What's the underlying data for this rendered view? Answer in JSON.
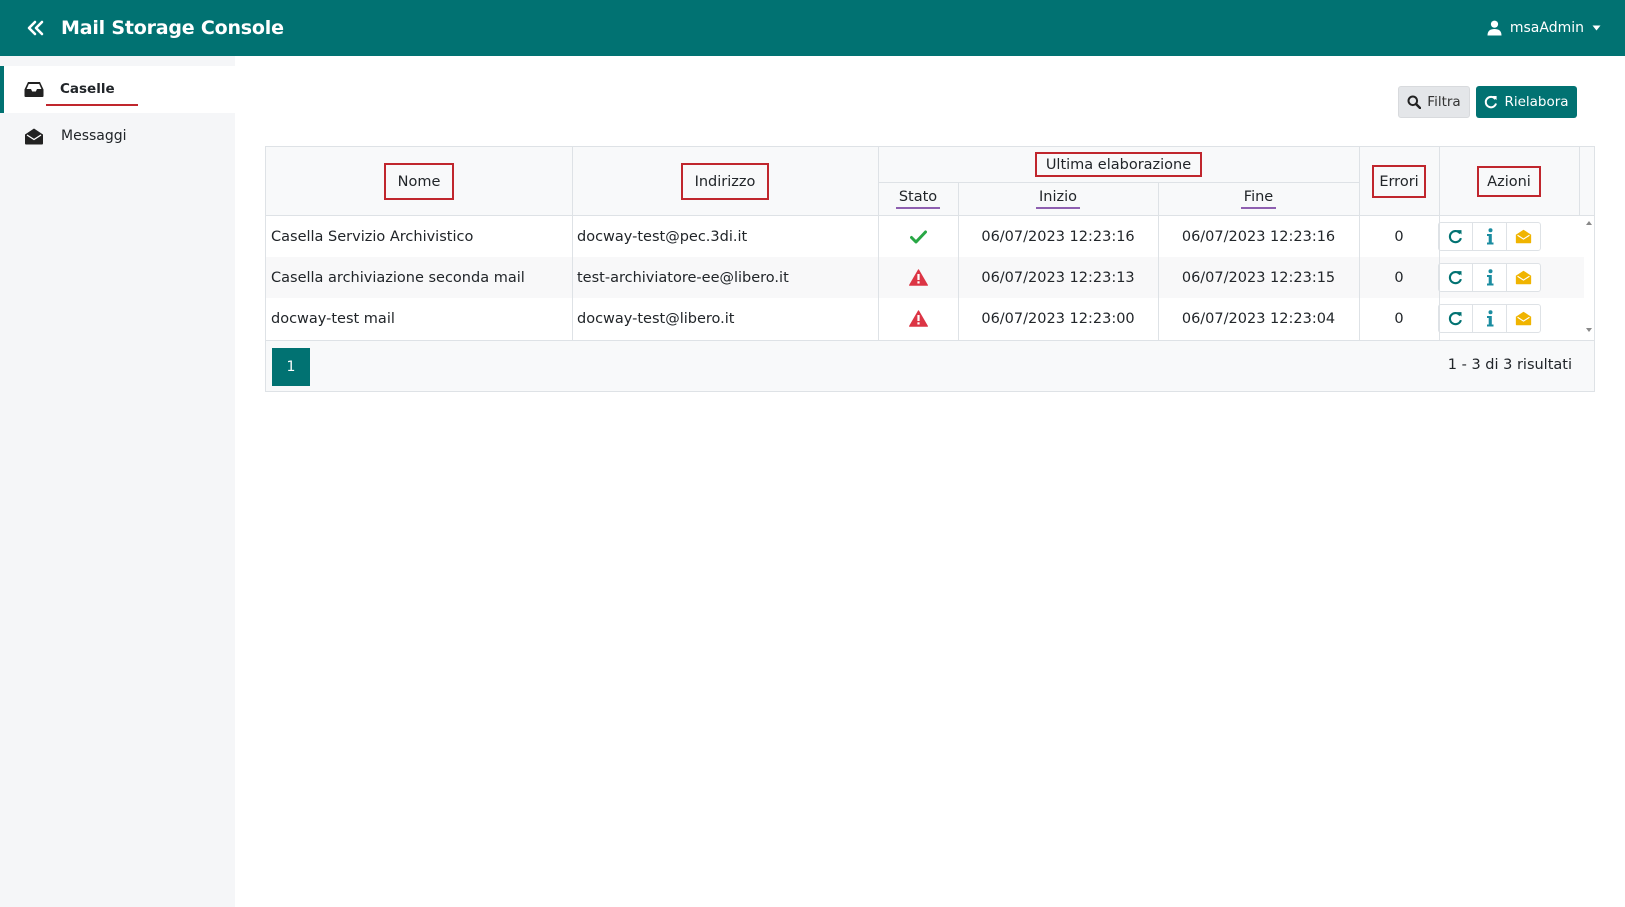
{
  "header": {
    "title": "Mail Storage Console",
    "user": "msaAdmin",
    "background": "#017272"
  },
  "sidebar": {
    "items": [
      {
        "label": "Caselle",
        "icon": "inbox-icon",
        "active": true
      },
      {
        "label": "Messaggi",
        "icon": "envelope-open-icon",
        "active": false
      }
    ]
  },
  "toolbar": {
    "filter_label": "Filtra",
    "rework_label": "Rielabora"
  },
  "table": {
    "headers": {
      "nome": "Nome",
      "indirizzo": "Indirizzo",
      "ultima": "Ultima elaborazione",
      "stato": "Stato",
      "inizio": "Inizio",
      "fine": "Fine",
      "errori": "Errori",
      "azioni": "Azioni"
    },
    "rows": [
      {
        "nome": "Casella Servizio Archivistico",
        "indirizzo": "docway-test@pec.3di.it",
        "stato": "ok",
        "inizio": "06/07/2023 12:23:16",
        "fine": "06/07/2023 12:23:16",
        "errori": "0"
      },
      {
        "nome": "Casella archiviazione seconda mail",
        "indirizzo": "test-archiviatore-ee@libero.it",
        "stato": "warning",
        "inizio": "06/07/2023 12:23:13",
        "fine": "06/07/2023 12:23:15",
        "errori": "0"
      },
      {
        "nome": "docway-test mail",
        "indirizzo": "docway-test@libero.it",
        "stato": "warning",
        "inizio": "06/07/2023 12:23:00",
        "fine": "06/07/2023 12:23:04",
        "errori": "0"
      }
    ],
    "action_icons": [
      "refresh-icon",
      "info-icon",
      "envelope-open-icon"
    ],
    "colors": {
      "ok": "#28a745",
      "warning": "#dc3545",
      "info": "#1a8ca0",
      "mail": "#f0b400"
    }
  },
  "pagination": {
    "current_page": "1",
    "info": "1 - 3 di 3 risultati"
  }
}
